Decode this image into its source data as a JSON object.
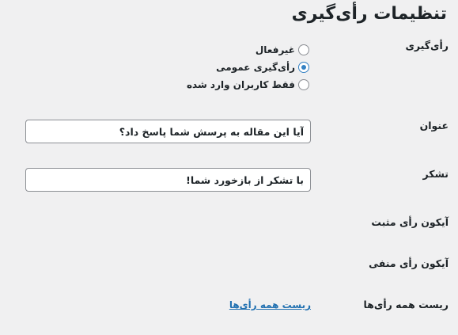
{
  "page": {
    "title": "تنظیمات رأی‌گیری"
  },
  "voting": {
    "label": "رأی‌گیری",
    "options": [
      {
        "label": "غیرفعال",
        "checked": false
      },
      {
        "label": "رأی‌گیری عمومی",
        "checked": true
      },
      {
        "label": "فقط کاربران وارد شده",
        "checked": false
      }
    ]
  },
  "title_field": {
    "label": "عنوان",
    "value": "آیا این مقاله به پرسش شما پاسخ داد؟"
  },
  "thanks_field": {
    "label": "تشکر",
    "value": "با تشکر از بازخورد شما!"
  },
  "positive_icon": {
    "label": "آیکون رأی مثبت"
  },
  "negative_icon": {
    "label": "آیکون رأی منفی"
  },
  "reset": {
    "label": "ریست همه رأی‌ها",
    "link_text": "ریست همه رأی‌ها"
  },
  "colors": {
    "background": "#f0f0f1",
    "accent": "#3582c4",
    "link": "#2271b1"
  }
}
